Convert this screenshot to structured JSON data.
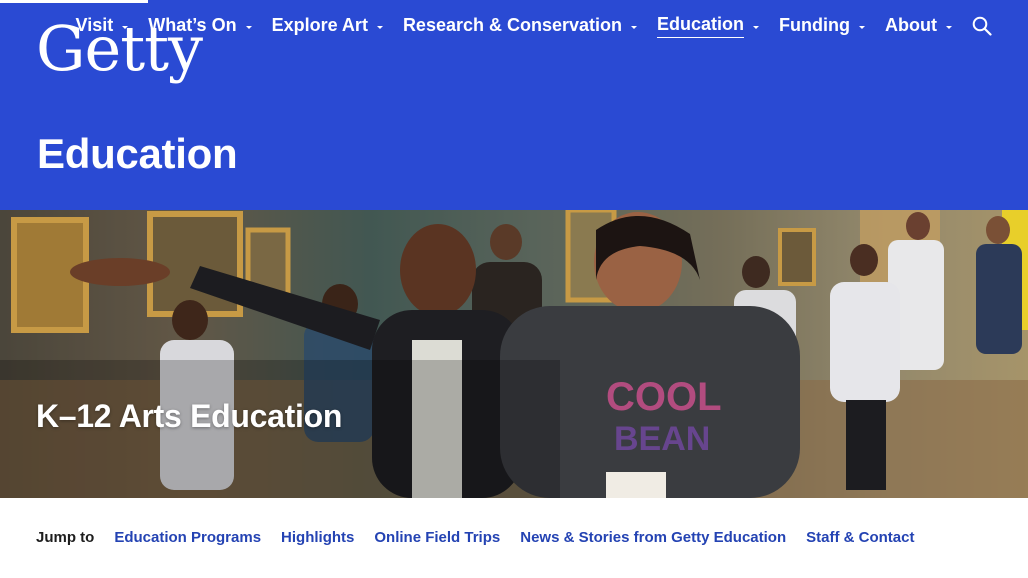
{
  "header": {
    "logo_text": "Getty",
    "background_color": "#2a4ad3",
    "nav": [
      {
        "label": "Visit",
        "active": false
      },
      {
        "label": "What’s On",
        "active": false
      },
      {
        "label": "Explore Art",
        "active": false
      },
      {
        "label": "Research & Conservation",
        "active": false
      },
      {
        "label": "Education",
        "active": true
      },
      {
        "label": "Funding",
        "active": false
      },
      {
        "label": "About",
        "active": false
      }
    ],
    "search_icon": "search-icon"
  },
  "page": {
    "title": "Education"
  },
  "hero": {
    "title": "K–12 Arts Education"
  },
  "jump_to": {
    "label": "Jump to",
    "links": [
      "Education Programs",
      "Highlights",
      "Online Field Trips",
      "News & Stories from Getty Education",
      "Staff & Contact"
    ],
    "link_color": "#2443b3"
  }
}
